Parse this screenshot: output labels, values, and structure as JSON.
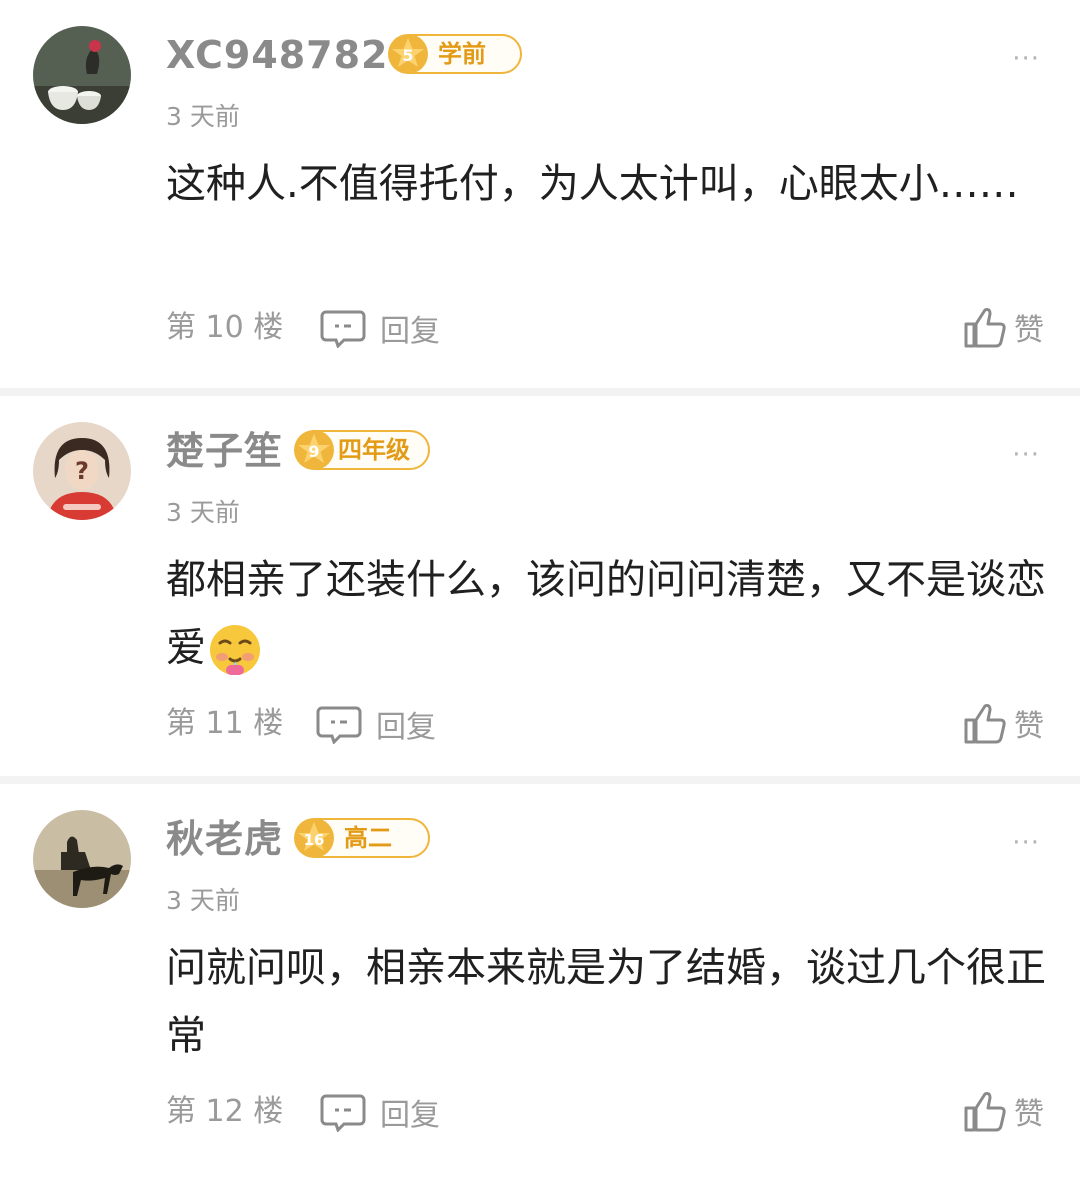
{
  "comments": [
    {
      "username": "XC948782",
      "level_num": "5",
      "level_label": "学前",
      "time": "3 天前",
      "content": "这种人.不值得托付，为人太计叫，心眼太小……",
      "floor": "第 10 楼",
      "reply_label": "回复",
      "like_label": "赞",
      "avatar_icon": "tea-cup-avatar"
    },
    {
      "username": "楚子笙",
      "level_num": "9",
      "level_label": "四年级",
      "time": "3 天前",
      "content": "都相亲了还装什么，该问的问问清楚，又不是谈恋爱",
      "emoji": "drooling-face-emoji",
      "floor": "第 11 楼",
      "reply_label": "回复",
      "like_label": "赞",
      "avatar_icon": "person-question-avatar"
    },
    {
      "username": "秋老虎",
      "level_num": "16",
      "level_label": "高二",
      "time": "3 天前",
      "content": "问就问呗，相亲本来就是为了结婚，谈过几个很正常",
      "floor": "第 12 楼",
      "reply_label": "回复",
      "like_label": "赞",
      "avatar_icon": "horse-rider-avatar"
    }
  ],
  "more_label": "···",
  "colors": {
    "badge": "#f0b63c",
    "badge_text": "#e39b16",
    "muted": "#9a9a9a",
    "divider": "#f3f3f3"
  }
}
